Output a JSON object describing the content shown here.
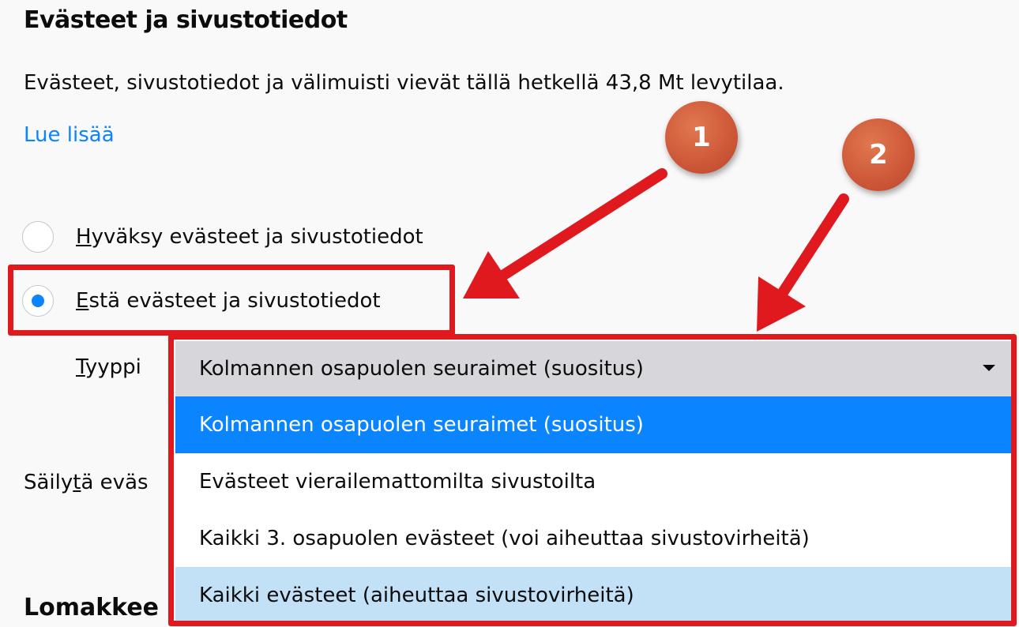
{
  "section": {
    "title": "Evästeet ja sivustotiedot",
    "description": "Evästeet, sivustotiedot ja välimuisti vievät tällä hetkellä 43,8 Mt levytilaa.",
    "learn_more": "Lue lisää"
  },
  "radios": [
    {
      "ak": "H",
      "label": "yväksy evästeet ja sivustotiedot",
      "checked": false
    },
    {
      "ak": "E",
      "label": "stä evästeet ja sivustotiedot",
      "checked": true
    }
  ],
  "type_field": {
    "ak": "T",
    "label": "yyppi",
    "selected": "Kolmannen osapuolen seuraimet (suositus)",
    "options": [
      "Kolmannen osapuolen seuraimet (suositus)",
      "Evästeet vierailemattomilta sivustoilta",
      "Kaikki 3. osapuolen evästeet (voi aiheuttaa sivustovirheitä)",
      "Kaikki evästeet (aiheuttaa sivustovirheitä)"
    ]
  },
  "keep": {
    "pre": "Säily",
    "ak": "t",
    "post": "ä eväs"
  },
  "forms_heading": "Lomakkee",
  "annotations": {
    "badge1": "1",
    "badge2": "2"
  },
  "colors": {
    "accent": "#0a84ff",
    "annotation_red": "#e0191f",
    "badge": "#cf5a3a",
    "hover_option": "#c2e1f7"
  }
}
